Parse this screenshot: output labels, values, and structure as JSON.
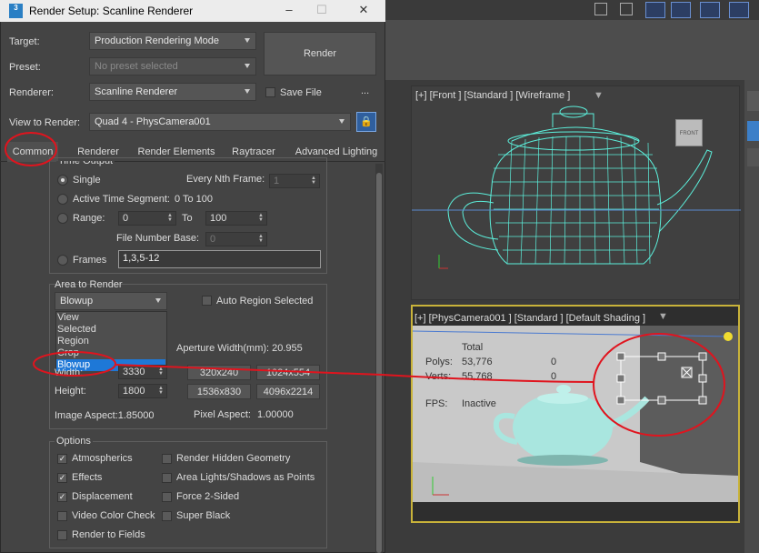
{
  "dialog": {
    "title": "Render Setup: Scanline Renderer",
    "logo_text": "3"
  },
  "top": {
    "target_label": "Target:",
    "target_value": "Production Rendering Mode",
    "preset_label": "Preset:",
    "preset_value": "No preset selected",
    "renderer_label": "Renderer:",
    "renderer_value": "Scanline Renderer",
    "save_file_label": "Save File",
    "more_label": "...",
    "render_button": "Render",
    "view_label": "View to Render:",
    "view_value": "Quad 4 - PhysCamera001"
  },
  "tabs": [
    "Common",
    "Renderer",
    "Render Elements",
    "Raytracer",
    "Advanced Lighting"
  ],
  "time_output": {
    "legend": "Time Output",
    "single": "Single",
    "every_nth_label": "Every Nth Frame:",
    "every_nth_value": "1",
    "active_segment": "Active Time Segment:",
    "active_segment_value": "0 To 100",
    "range": "Range:",
    "range_from": "0",
    "range_to_label": "To",
    "range_to": "100",
    "file_base_label": "File Number Base:",
    "file_base_value": "0",
    "frames": "Frames",
    "frames_value": "1,3,5-12"
  },
  "area": {
    "legend": "Area to Render",
    "value": "Blowup",
    "auto_region": "Auto Region Selected",
    "options": [
      "View",
      "Selected",
      "Region",
      "Crop",
      "Blowup"
    ]
  },
  "output_size": {
    "aperture": "Aperture Width(mm): 20.955",
    "width_label": "Width:",
    "width_value": "3330",
    "height_label": "Height:",
    "height_value": "1800",
    "presets": [
      "320x240",
      "1024x554",
      "1536x830",
      "4096x2214"
    ],
    "image_aspect": "Image Aspect:1.85000",
    "pixel_aspect_label": "Pixel Aspect:",
    "pixel_aspect_value": "1.00000"
  },
  "options": {
    "legend": "Options",
    "left": [
      {
        "label": "Atmospherics",
        "checked": true
      },
      {
        "label": "Effects",
        "checked": true
      },
      {
        "label": "Displacement",
        "checked": true
      },
      {
        "label": "Video Color Check",
        "checked": false
      },
      {
        "label": "Render to Fields",
        "checked": false
      }
    ],
    "right": [
      {
        "label": "Render Hidden Geometry",
        "checked": false
      },
      {
        "label": "Area Lights/Shadows as Points",
        "checked": false
      },
      {
        "label": "Force 2-Sided",
        "checked": false
      },
      {
        "label": "Super Black",
        "checked": false
      }
    ]
  },
  "viewports": {
    "front_label": "[+] [Front ] [Standard ] [Wireframe ]",
    "cam_label": "[+] [PhysCamera001 ] [Standard ] [Default Shading ]",
    "viewcube": "FRONT"
  },
  "stats": {
    "total": "Total",
    "polys_label": "Polys:",
    "polys_value": "53,776",
    "polys_sel": "0",
    "verts_label": "Verts:",
    "verts_value": "55,768",
    "verts_sel": "0",
    "fps_label": "FPS:",
    "fps_value": "Inactive"
  },
  "colors": {
    "annotation": "#e0141e",
    "selection": "#1e78d7",
    "viewport_border": "#c9b33a",
    "wireframe": "#5cf0dc"
  }
}
